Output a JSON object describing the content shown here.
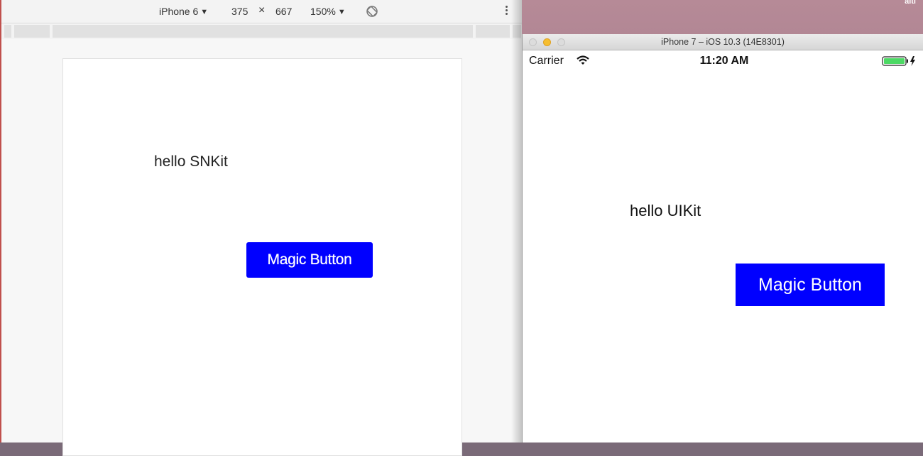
{
  "devtools": {
    "device": "iPhone 6",
    "width": "375",
    "times": "×",
    "height": "667",
    "zoom": "150%"
  },
  "web_page": {
    "hello_text": "hello SNKit",
    "button_label": "Magic Button",
    "button_color": "#0000ff"
  },
  "simulator": {
    "window_title": "iPhone 7 – iOS 10.3 (14E8301)",
    "carrier": "Carrier",
    "time": "11:20 AM",
    "hello_text": "hello UIKit",
    "button_label": "Magic Button",
    "button_color": "#0000ff",
    "battery_color": "#4cd964"
  },
  "icons": {
    "rotate": "rotate-icon",
    "more": "kebab-menu-icon",
    "wifi": "wifi-icon",
    "battery": "battery-charging-icon"
  }
}
